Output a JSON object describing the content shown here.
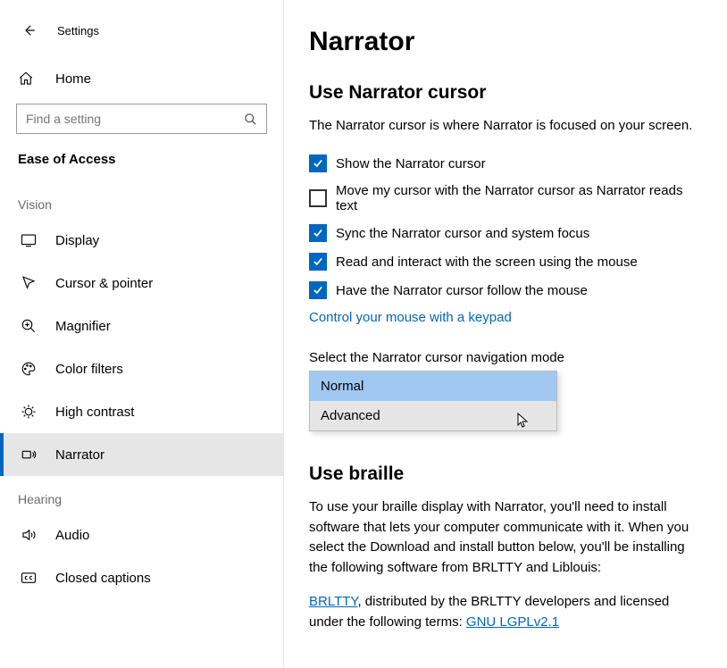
{
  "app": {
    "title": "Settings"
  },
  "sidebar": {
    "home": "Home",
    "search_placeholder": "Find a setting",
    "section": "Ease of Access",
    "groups": [
      {
        "label": "Vision",
        "items": [
          {
            "id": "display",
            "label": "Display"
          },
          {
            "id": "cursor",
            "label": "Cursor & pointer"
          },
          {
            "id": "magnifier",
            "label": "Magnifier"
          },
          {
            "id": "colorfilters",
            "label": "Color filters"
          },
          {
            "id": "highcontrast",
            "label": "High contrast"
          },
          {
            "id": "narrator",
            "label": "Narrator",
            "selected": true
          }
        ]
      },
      {
        "label": "Hearing",
        "items": [
          {
            "id": "audio",
            "label": "Audio"
          },
          {
            "id": "cc",
            "label": "Closed captions"
          }
        ]
      }
    ]
  },
  "main": {
    "title": "Narrator",
    "cursor_section_title": "Use Narrator cursor",
    "cursor_desc": "The Narrator cursor is where Narrator is focused on your screen.",
    "checks": [
      {
        "label": "Show the Narrator cursor",
        "checked": true
      },
      {
        "label": "Move my cursor with the Narrator cursor as Narrator reads text",
        "checked": false
      },
      {
        "label": "Sync the Narrator cursor and system focus",
        "checked": true
      },
      {
        "label": "Read and interact with the screen using the mouse",
        "checked": true
      },
      {
        "label": "Have the Narrator cursor follow the mouse",
        "checked": true
      }
    ],
    "keypad_link": "Control your mouse with a keypad",
    "nav_mode_label": "Select the Narrator cursor navigation mode",
    "nav_mode_options": [
      "Normal",
      "Advanced"
    ],
    "nav_mode_selected": "Normal",
    "braille_title": "Use braille",
    "braille_desc": "To use your braille display with Narrator, you'll need to install software that lets your computer communicate with it. When you select the Download and install button below, you'll be installing the following software from BRLTTY and Liblouis:",
    "brltty_link": "BRLTTY",
    "brltty_rest": ", distributed by the BRLTTY developers and licensed under the following terms: ",
    "lgpl_link": "GNU LGPLv2.1"
  }
}
